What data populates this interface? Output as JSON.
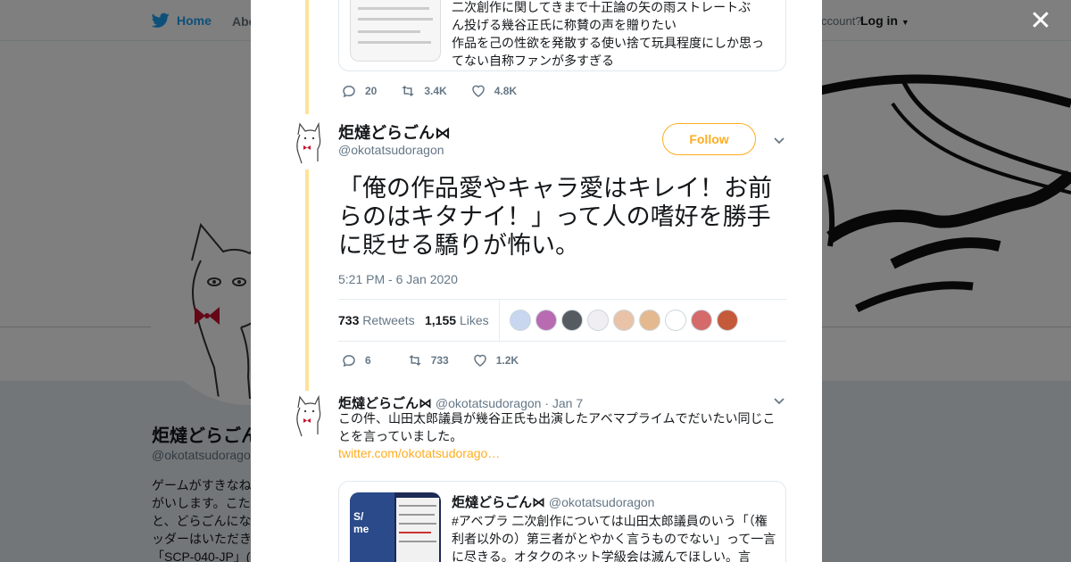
{
  "background": {
    "nav": {
      "home": "Home",
      "about": "Abo",
      "account_prompt": "ccount?",
      "login": "Log in"
    },
    "profile": {
      "name": "炬燵どらごん",
      "handle": "@okotatsudorago",
      "bio": "ゲームがすきなね\nがいします。こた\nと、どらごんにな\nッダーはいただき\n「SCP-040-JP」("
    }
  },
  "modal": {
    "top_card": {
      "lines": [
        "二次創作に関してきまで十正論の矢の雨ストレートぶ",
        "ん投げる幾谷正氏に称賛の声を贈りたい",
        "作品を己の性欲を発散する使い捨て玩具程度にしか思っ",
        "てない自称ファンが多すぎる"
      ]
    },
    "top_actions": {
      "replies": "20",
      "retweets": "3.4K",
      "likes": "4.8K"
    },
    "main_tweet": {
      "name": "炬燵どらごん⋈",
      "handle": "@okotatsudoragon",
      "follow_label": "Follow",
      "text": "「俺の作品愛やキャラ愛はキレイ！お前らのはキタナイ！」って人の嗜好を勝手に貶せる驕りが怖い。",
      "timestamp": "5:21 PM - 6 Jan 2020",
      "retweets_count": "733",
      "retweets_label": "Retweets",
      "likes_count": "1,155",
      "likes_label": "Likes",
      "liker_colors": [
        "#c9d6ef",
        "#b86bb0",
        "#555b60",
        "#f1eef2",
        "#e9c3a8",
        "#e5b98f",
        "#ffffff",
        "#d46a6a",
        "#c45a3a"
      ],
      "actions": {
        "replies": "6",
        "retweets": "733",
        "likes": "1.2K"
      }
    },
    "reply_tweet": {
      "name": "炬燵どらごん⋈",
      "handle": "@okotatsudoragon",
      "date": "· Jan 7",
      "text": "この件、山田太郎議員が幾谷正氏も出演したアベマプライムでだいたい同じことを言っていました。",
      "link": "twitter.com/okotatsudorago…",
      "quote": {
        "name": "炬燵どらごん⋈",
        "handle": "@okotatsudoragon",
        "text": "#アベプラ 二次創作については山田太郎議員のいう「（権利者以外の）第三者がとやかく言うものでない」って一言に尽きる。オタクのネット学級会は滅んでほしい。言"
      }
    }
  },
  "colors": {
    "accent": "#ffad1f",
    "twitter_blue": "#1da1f2",
    "thread": "#ffe299"
  }
}
